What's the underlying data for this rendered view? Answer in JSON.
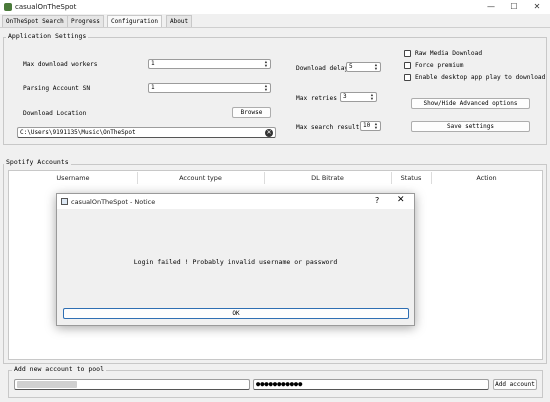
{
  "window": {
    "title": "casualOnTheSpot",
    "minimize": "—",
    "maximize": "☐",
    "close": "✕"
  },
  "tabs": [
    {
      "label": "OnTheSpot Search"
    },
    {
      "label": "Progress"
    },
    {
      "label": "Configuration"
    },
    {
      "label": "About"
    }
  ],
  "app_settings": {
    "group_label": "Application Settings",
    "max_download_workers": {
      "label": "Max download workers",
      "value": "1"
    },
    "parsing_account_sn": {
      "label": "Parsing Account SN",
      "value": "1"
    },
    "download_location": {
      "label": "Download Location",
      "browse": "Browse",
      "path": "C:\\Users\\9191135\\Music\\OnTheSpot"
    },
    "download_delay": {
      "label": "Download delay",
      "value": "5"
    },
    "max_retries": {
      "label": "Max retries",
      "value": "3"
    },
    "max_search_results": {
      "label": "Max search results",
      "value": "10"
    },
    "checkboxes": [
      {
        "label": "Raw Media Download"
      },
      {
        "label": "Force premium"
      },
      {
        "label": "Enable desktop app play to download"
      }
    ],
    "advanced_button": "Show/Hide Advanced options",
    "save_button": "Save settings"
  },
  "accounts": {
    "group_label": "Spotify Accounts",
    "columns": [
      "Username",
      "Account type",
      "DL Bitrate",
      "Status",
      "Action"
    ]
  },
  "add_account": {
    "label": "Add new account to pool",
    "password_value": "●●●●●●●●●●●",
    "button": "Add account"
  },
  "dialog": {
    "title": "casualOnTheSpot - Notice",
    "help": "?",
    "close": "✕",
    "message": "Login failed ! Probably invalid username or password",
    "ok": "OK"
  },
  "colors": {
    "accent": "#2f6fb3",
    "app_icon": "#4a7a3a"
  }
}
